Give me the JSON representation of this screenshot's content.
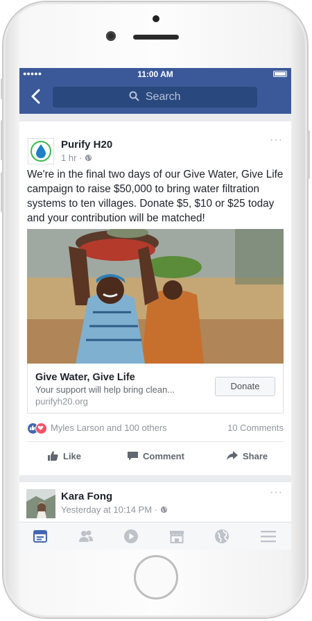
{
  "status_bar": {
    "signal": "●●●●●",
    "time": "11:00 AM"
  },
  "nav": {
    "back_icon": "chevron-left-icon",
    "search_placeholder": "Search"
  },
  "post": {
    "page_name": "Purify H20",
    "time": "1 hr",
    "privacy_icon": "globe-icon",
    "more": "···",
    "text": "We're in the final two days of our Give Water, Give Life campaign to raise $50,000 to bring water filtration systems to ten villages. Donate $5, $10 or $25 today and your contribution will be matched!",
    "link": {
      "title": "Give Water, Give Life",
      "description": "Your support will help bring clean...",
      "url": "purifyh20.org",
      "button": "Donate"
    },
    "reactions": {
      "names": "Myles Larson and 100 others",
      "comments": "10 Comments"
    },
    "actions": {
      "like": "Like",
      "comment": "Comment",
      "share": "Share"
    }
  },
  "post2": {
    "name": "Kara Fong",
    "time": "Yesterday at 10:14 PM",
    "more": "···"
  },
  "tabbar": {
    "items": [
      "news-feed-icon",
      "friends-icon",
      "video-icon",
      "marketplace-icon",
      "globe-icon",
      "menu-icon"
    ],
    "active_color": "#4267b2",
    "inactive_color": "#bec2c9"
  },
  "colors": {
    "brand": "#3b5998",
    "love": "#f25268"
  }
}
